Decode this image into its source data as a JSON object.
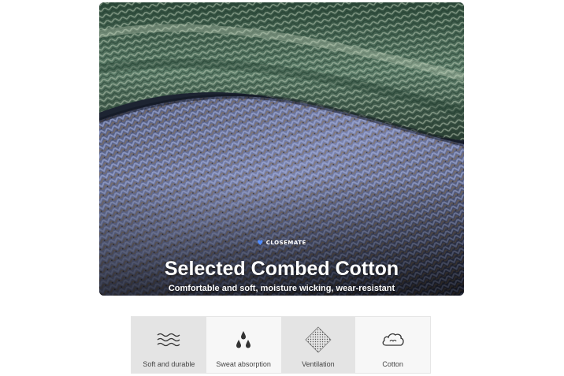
{
  "hero": {
    "brand": "CLOSEMATE",
    "title": "Selected Combed Cotton",
    "subtitle": "Comfortable and soft, moisture wicking, wear-resistant"
  },
  "features": [
    {
      "label": "Soft and durable",
      "icon": "waves-icon"
    },
    {
      "label": "Sweat absorption",
      "icon": "droplets-icon"
    },
    {
      "label": "Ventilation",
      "icon": "mesh-icon"
    },
    {
      "label": "Cotton",
      "icon": "cotton-cloud-icon"
    }
  ],
  "colors": {
    "green_knit": "#3f6a52",
    "blue_knit": "#6f7aa8",
    "brown_knit": "#7a6a58",
    "feature_shade": "#e4e4e4",
    "brand_heart": "#4f8cff"
  }
}
